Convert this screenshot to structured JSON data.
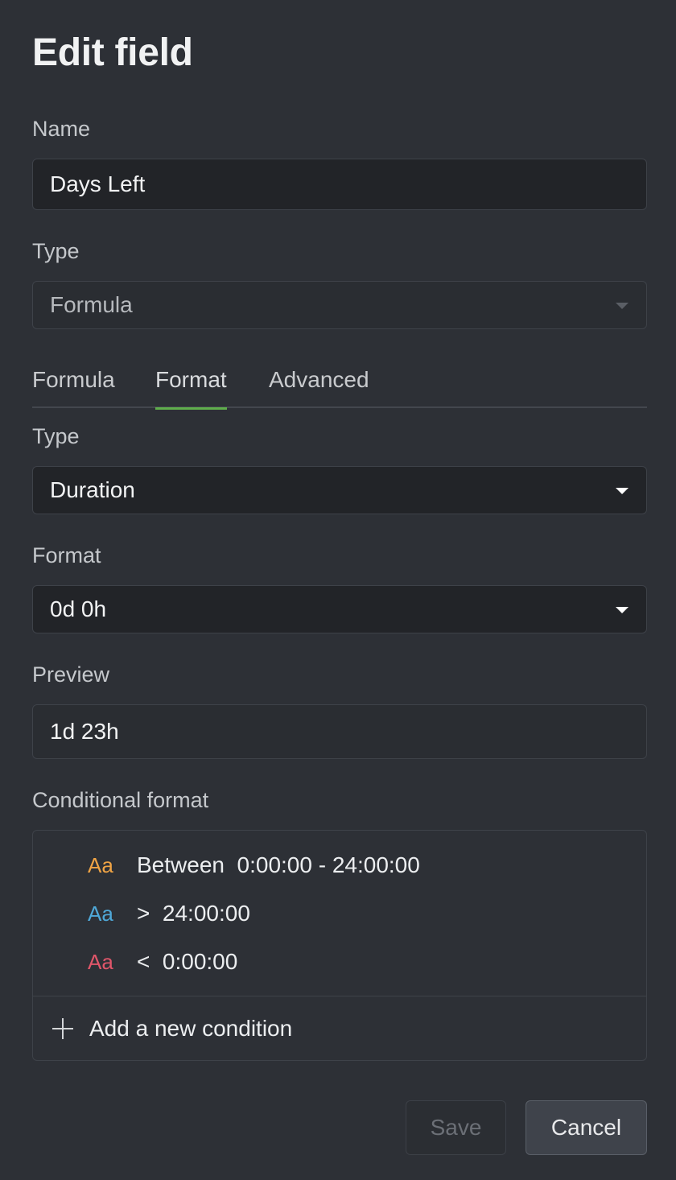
{
  "dialog": {
    "title": "Edit field",
    "name_label": "Name",
    "name_value": "Days Left",
    "type_label": "Type",
    "type_value": "Formula"
  },
  "tabs": [
    {
      "label": "Formula",
      "active": false
    },
    {
      "label": "Format",
      "active": true
    },
    {
      "label": "Advanced",
      "active": false
    }
  ],
  "format": {
    "type_label": "Type",
    "type_value": "Duration",
    "format_label": "Format",
    "format_value": "0d 0h",
    "preview_label": "Preview",
    "preview_value": "1d 23h"
  },
  "conditional": {
    "label": "Conditional format",
    "rules": [
      {
        "icon_text": "Aa",
        "color": "#f0a445",
        "text": "Between  0:00:00 - 24:00:00"
      },
      {
        "icon_text": "Aa",
        "color": "#4fa8d8",
        "text": ">  24:00:00"
      },
      {
        "icon_text": "Aa",
        "color": "#e0566a",
        "text": "<  0:00:00"
      }
    ],
    "add_label": "Add a new condition",
    "add_icon": "plus-icon"
  },
  "buttons": {
    "save": "Save",
    "cancel": "Cancel"
  },
  "colors": {
    "background": "#2d3036",
    "accent": "#5fae4c"
  }
}
